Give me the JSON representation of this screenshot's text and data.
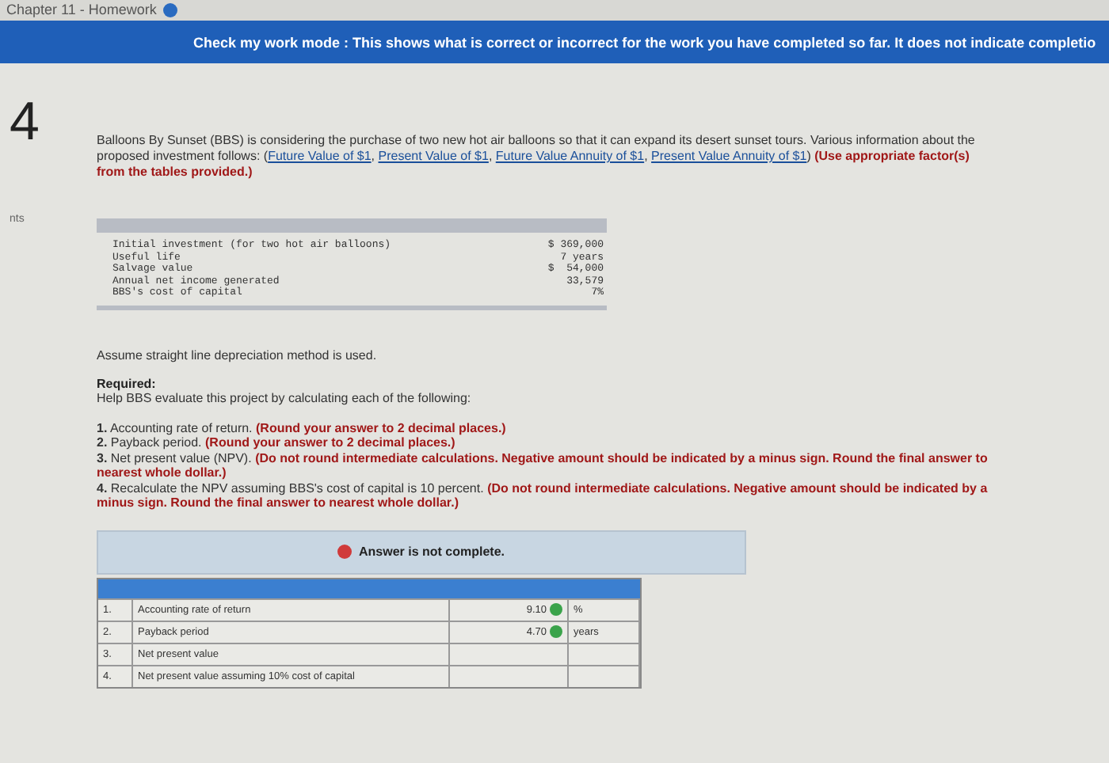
{
  "header": {
    "title": "Chapter 11 - Homework"
  },
  "banner": {
    "text": "Check my work mode : This shows what is correct or incorrect for the work you have completed so far. It does not indicate completio"
  },
  "side_label": "nts",
  "question": {
    "number": "4",
    "intro": "Balloons By Sunset (BBS) is considering the purchase of two new hot air balloons so that it can expand its desert sunset tours. Various information about the proposed investment follows: (",
    "links": [
      "Future Value of $1",
      "Present Value of $1",
      "Future Value Annuity of $1",
      "Present Value Annuity of $1"
    ],
    "link_separator": ", ",
    "intro_end": ")",
    "instruction": "(Use appropriate factor(s) from the tables provided.)"
  },
  "facts": [
    {
      "label": "Initial investment (for two hot air balloons)",
      "value": "$ 369,000"
    },
    {
      "label": "Useful life",
      "value": "7 years"
    },
    {
      "label": "Salvage value",
      "value": "$  54,000"
    },
    {
      "label": "Annual net income generated",
      "value": "33,579"
    },
    {
      "label": "BBS's cost of capital",
      "value": "7%"
    }
  ],
  "assumption": "Assume straight line depreciation method is used.",
  "required": {
    "heading": "Required:",
    "lead": "Help BBS evaluate this project by calculating each of the following:",
    "items": [
      {
        "text": "**1.** Accounting rate of return.",
        "note": "(Round your answer to 2 decimal places.)"
      },
      {
        "text": "**2.** Payback period.",
        "note": "(Round your answer to 2 decimal places.)"
      },
      {
        "text": "**3.** Net present value (NPV).",
        "note": "(Do not round intermediate calculations. Negative amount should be indicated by a minus sign. Round the final answer to nearest whole dollar.)"
      },
      {
        "text": "**4.** Recalculate the NPV assuming BBS's cost of capital is 10 percent.",
        "note": "(Do not round intermediate calculations. Negative amount should be indicated by a minus sign. Round the final answer to nearest whole dollar.)"
      }
    ]
  },
  "answer": {
    "status": "Answer is not complete.",
    "complete": false,
    "rows": [
      {
        "num": "1.",
        "label": "Accounting rate of return",
        "value": "9.10",
        "correct": true,
        "unit": "%"
      },
      {
        "num": "2.",
        "label": "Payback period",
        "value": "4.70",
        "correct": true,
        "unit": "years"
      },
      {
        "num": "3.",
        "label": "Net present value",
        "value": "",
        "correct": false,
        "unit": ""
      },
      {
        "num": "4.",
        "label": "Net present value assuming 10% cost of capital",
        "value": "",
        "correct": false,
        "unit": ""
      }
    ]
  }
}
